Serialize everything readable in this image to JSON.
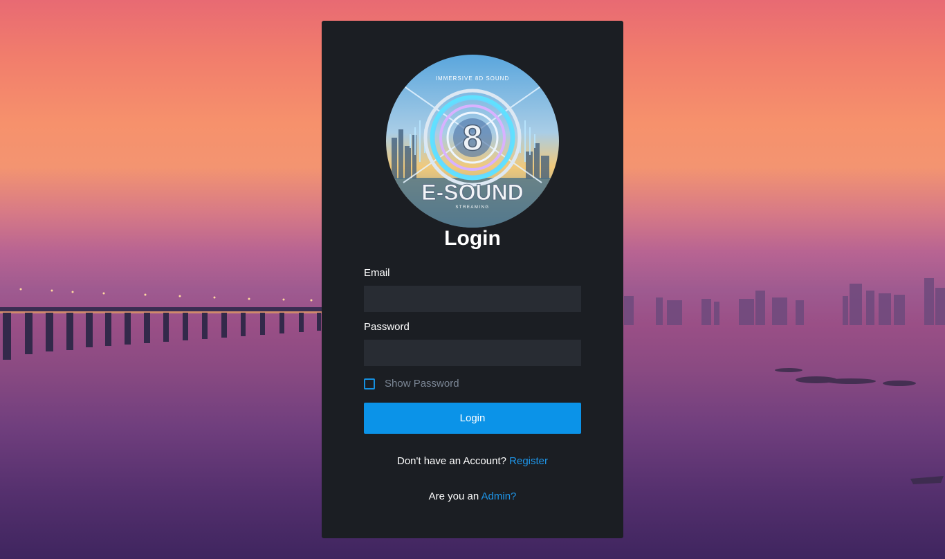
{
  "logo": {
    "top_text": "IMMERSIVE 8D SOUND",
    "numeral": "8",
    "brand": "E-SOUND",
    "sub_text": "STREAMING"
  },
  "form": {
    "title": "Login",
    "email_label": "Email",
    "email_value": "",
    "password_label": "Password",
    "password_value": "",
    "show_password_label": "Show Password",
    "show_password_checked": false,
    "submit_label": "Login"
  },
  "footer": {
    "register_prompt": "Don't have an Account?",
    "register_link": "Register",
    "admin_prompt": "Are you an",
    "admin_link": "Admin?"
  },
  "colors": {
    "card_bg": "#1b1e23",
    "input_bg": "#282c33",
    "accent": "#0b93e8",
    "link": "#1e96ea"
  }
}
